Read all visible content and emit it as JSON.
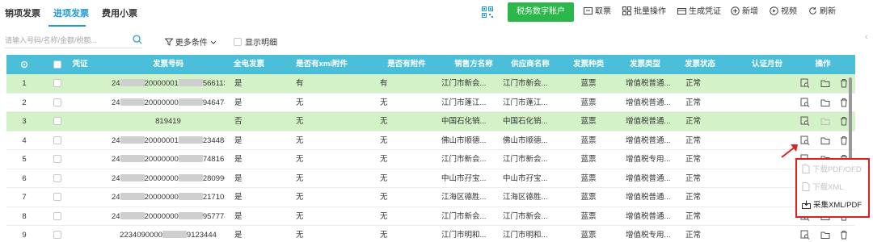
{
  "tabs": [
    {
      "label": "销项发票"
    },
    {
      "label": "进项发票"
    },
    {
      "label": "费用小票"
    }
  ],
  "toolbar": {
    "tax_account": "税务数字账户",
    "fetch": "取票",
    "batch": "批量操作",
    "voucher": "生成凭证",
    "add": "新增",
    "video": "视频",
    "refresh": "刷新"
  },
  "filters": {
    "search_placeholder": "请输入号码/名称/金额/税额...",
    "more": "更多条件",
    "show_detail": "显示明细"
  },
  "table": {
    "headers": [
      "凭证",
      "发票号码",
      "全电发票",
      "是否有xml附件",
      "是否有附件",
      "销售方名称",
      "供应商名称",
      "发票种类",
      "发票类型",
      "发票状态",
      "认证月份",
      "操作"
    ],
    "rows": [
      {
        "idx": "1",
        "pre": "24",
        "mid": "20000001",
        "suf": "566113",
        "qd": "是",
        "xml": "有",
        "att": "有",
        "seller": "江门市新会...",
        "supplier": "江门市新会...",
        "kind": "蓝票",
        "type": "增值税普通...",
        "status": "正常",
        "hl": true
      },
      {
        "idx": "2",
        "pre": "24",
        "mid": "20000000",
        "suf": "946474",
        "qd": "是",
        "xml": "无",
        "att": "无",
        "seller": "江门市蓬江...",
        "supplier": "江门市蓬江...",
        "kind": "蓝票",
        "type": "增值税普通...",
        "status": "正常",
        "hl": false
      },
      {
        "idx": "3",
        "pre": "",
        "mid": "819419",
        "suf": "",
        "qd": "否",
        "xml": "无",
        "att": "无",
        "seller": "中国石化销...",
        "supplier": "中国石化销...",
        "kind": "蓝票",
        "type": "增值税普通...",
        "status": "正常",
        "hl": true
      },
      {
        "idx": "4",
        "pre": "24",
        "mid": "20000001",
        "suf": "234488",
        "qd": "是",
        "xml": "无",
        "att": "无",
        "seller": "佛山市顺德...",
        "supplier": "佛山市顺德...",
        "kind": "蓝票",
        "type": "增值税普通...",
        "status": "正常",
        "hl": false
      },
      {
        "idx": "5",
        "pre": "24",
        "mid": "20000000",
        "suf": "748161",
        "qd": "是",
        "xml": "无",
        "att": "无",
        "seller": "江门市新会...",
        "supplier": "江门市新会...",
        "kind": "蓝票",
        "type": "增值税专用...",
        "status": "正常",
        "hl": false
      },
      {
        "idx": "6",
        "pre": "24",
        "mid": "20000000",
        "suf": "280990",
        "qd": "是",
        "xml": "无",
        "att": "无",
        "seller": "中山市孖宝...",
        "supplier": "中山市孖宝...",
        "kind": "蓝票",
        "type": "增值税普通...",
        "status": "正常",
        "hl": false
      },
      {
        "idx": "7",
        "pre": "24",
        "mid": "20000000",
        "suf": "217105",
        "qd": "是",
        "xml": "无",
        "att": "无",
        "seller": "江海区德胜...",
        "supplier": "江海区德胜...",
        "kind": "蓝票",
        "type": "增值税普通...",
        "status": "正常",
        "hl": false
      },
      {
        "idx": "8",
        "pre": "24",
        "mid": "20000000",
        "suf": "957774",
        "qd": "是",
        "xml": "无",
        "att": "无",
        "seller": "江门市新会...",
        "supplier": "江门市新会...",
        "kind": "蓝票",
        "type": "增值税普通...",
        "status": "正常",
        "hl": false
      },
      {
        "idx": "9",
        "pre": "2234090000",
        "mid": "",
        "suf": "9123444",
        "qd": "是",
        "xml": "无",
        "att": "无",
        "seller": "江门市明和...",
        "supplier": "江门市明和...",
        "kind": "蓝票",
        "type": "增值税专用...",
        "status": "正常",
        "hl": false
      }
    ]
  },
  "popup": {
    "download_pdf": "下载PDF/OFD",
    "download_xml": "下载XML",
    "collect": "采集XML/PDF"
  },
  "colors": {
    "accent": "#1a9bd7",
    "header_bg": "#4bbfd9",
    "green_button": "#2cb74b",
    "row_highlight": "#d3f2c8",
    "popup_border": "#e02020"
  }
}
